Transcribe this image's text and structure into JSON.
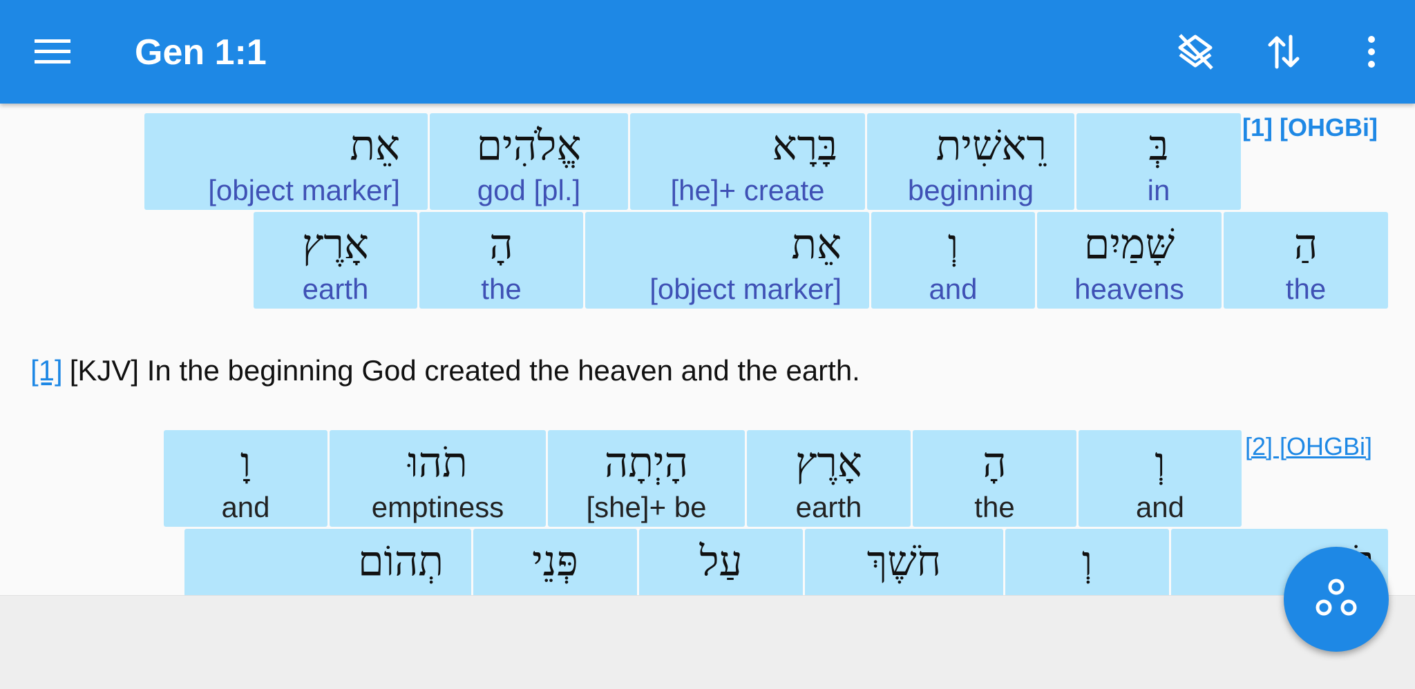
{
  "header": {
    "title": "Gen 1:1",
    "icons": {
      "menu": "menu-icon",
      "action1": "layers-off-icon",
      "action2": "swap-vertical-icon",
      "action3": "more-vert-icon"
    }
  },
  "verse1": {
    "ref": "[1] [OHGBi]",
    "row1": [
      {
        "heb": "בְּ",
        "gloss": "in"
      },
      {
        "heb": "רֵאשִׁית",
        "gloss": "beginning"
      },
      {
        "heb": "בָּרָא",
        "gloss": "[he]+ create"
      },
      {
        "heb": "אֱלֹהִים",
        "gloss": "god [pl.]"
      },
      {
        "heb": "אֵת",
        "gloss": "[object marker]"
      }
    ],
    "row2": [
      {
        "heb": "הַ",
        "gloss": "the"
      },
      {
        "heb": "שָּׁמַיִם",
        "gloss": "heavens"
      },
      {
        "heb": "וְ",
        "gloss": "and"
      },
      {
        "heb": "אֵת",
        "gloss": "[object marker]"
      },
      {
        "heb": "הָ",
        "gloss": "the"
      },
      {
        "heb": "אָרֶץ",
        "gloss": "earth"
      }
    ]
  },
  "kjv": {
    "ref": "[1]",
    "text": "[KJV] In the beginning God created the heaven and the earth."
  },
  "verse2": {
    "ref": "[2] [OHGBi]",
    "row1": [
      {
        "heb": "וְ",
        "gloss": "and"
      },
      {
        "heb": "הָ",
        "gloss": "the"
      },
      {
        "heb": "אָרֶץ",
        "gloss": "earth"
      },
      {
        "heb": "הָיְתָה",
        "gloss": "[she]+ be"
      },
      {
        "heb": "תֹהוּ",
        "gloss": "emptiness"
      },
      {
        "heb": "וָ",
        "gloss": "and"
      }
    ],
    "row2": [
      {
        "heb": "בֹהוּ"
      },
      {
        "heb": "וְ"
      },
      {
        "heb": "חֹשֶׁךְ"
      },
      {
        "heb": "עַל"
      },
      {
        "heb": "פְּנֵי"
      },
      {
        "heb": "תְהוֹם"
      }
    ]
  },
  "fab": {
    "icon": "share-nodes-icon"
  }
}
